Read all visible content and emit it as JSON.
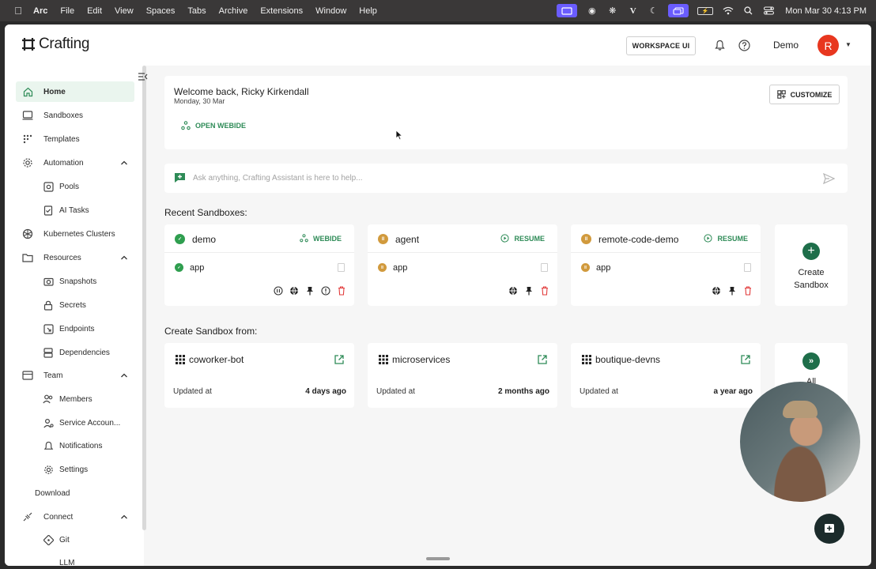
{
  "menubar": {
    "items": [
      "Arc",
      "File",
      "Edit",
      "View",
      "Spaces",
      "Tabs",
      "Archive",
      "Extensions",
      "Window",
      "Help"
    ],
    "clock": "Mon Mar 30  4:13 PM"
  },
  "topbar": {
    "brand": "Crafting",
    "workspace_button": "WORKSPACE UI",
    "user_name": "Demo",
    "avatar_initial": "R"
  },
  "sidebar": {
    "items": [
      {
        "label": "Home"
      },
      {
        "label": "Sandboxes"
      },
      {
        "label": "Templates"
      },
      {
        "label": "Automation"
      },
      {
        "label": "Pools"
      },
      {
        "label": "AI Tasks"
      },
      {
        "label": "Kubernetes Clusters"
      },
      {
        "label": "Resources"
      },
      {
        "label": "Snapshots"
      },
      {
        "label": "Secrets"
      },
      {
        "label": "Endpoints"
      },
      {
        "label": "Dependencies"
      },
      {
        "label": "Team"
      },
      {
        "label": "Members"
      },
      {
        "label": "Service Accoun..."
      },
      {
        "label": "Notifications"
      },
      {
        "label": "Settings"
      },
      {
        "label": "Download"
      },
      {
        "label": "Connect"
      },
      {
        "label": "Git"
      },
      {
        "label": "LLM"
      }
    ]
  },
  "welcome": {
    "title": "Welcome back, Ricky Kirkendall",
    "date": "Monday, 30 Mar",
    "open_webide": "OPEN WEBIDE",
    "customize": "CUSTOMIZE"
  },
  "assistant": {
    "placeholder": "Ask anything, Crafting Assistant is here to help..."
  },
  "recent": {
    "title": "Recent Sandboxes:",
    "cards": [
      {
        "name": "demo",
        "action": "WEBIDE",
        "workspace": "app",
        "status": "running",
        "status_color": "#2f9e4f"
      },
      {
        "name": "agent",
        "action": "RESUME",
        "workspace": "app",
        "status": "suspended",
        "status_color": "#d19a3d"
      },
      {
        "name": "remote-code-demo",
        "action": "RESUME",
        "workspace": "app",
        "status": "suspended",
        "status_color": "#d19a3d"
      }
    ],
    "create_label": "Create Sandbox"
  },
  "templates": {
    "title": "Create Sandbox from:",
    "cards": [
      {
        "name": "coworker-bot",
        "updated_label": "Updated at",
        "updated": "4 days ago"
      },
      {
        "name": "microservices",
        "updated_label": "Updated at",
        "updated": "2 months ago"
      },
      {
        "name": "boutique-devns",
        "updated_label": "Updated at",
        "updated": "a year ago"
      }
    ],
    "all_label": "All"
  },
  "colors": {
    "accent": "#2e8b57",
    "brand_dark": "#1e6e4a",
    "danger": "#e23b3b"
  }
}
